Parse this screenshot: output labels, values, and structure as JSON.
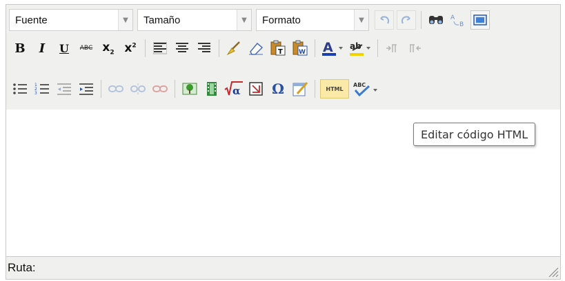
{
  "toolbar": {
    "font_combo": "Fuente",
    "size_combo": "Tamaño",
    "format_combo": "Formato",
    "bold": "B",
    "italic": "I",
    "underline": "U",
    "strikethrough": "ABC",
    "subscript_base": "x",
    "subscript_mark": "2",
    "superscript_base": "x",
    "superscript_mark": "2",
    "text_color_glyph": "A",
    "highlight_glyph": "ab",
    "omega_glyph": "Ω",
    "html_button_label": "HTML",
    "spell_label": "ABC"
  },
  "tooltip": {
    "text": "Editar código HTML"
  },
  "status": {
    "path_label": "Ruta:"
  },
  "colors": {
    "toolbar_bg": "#f0f0ee",
    "highlight": "#fbe9a7",
    "text_color_bar": "#1a3fb0",
    "highlight_bar": "#f2d300"
  }
}
